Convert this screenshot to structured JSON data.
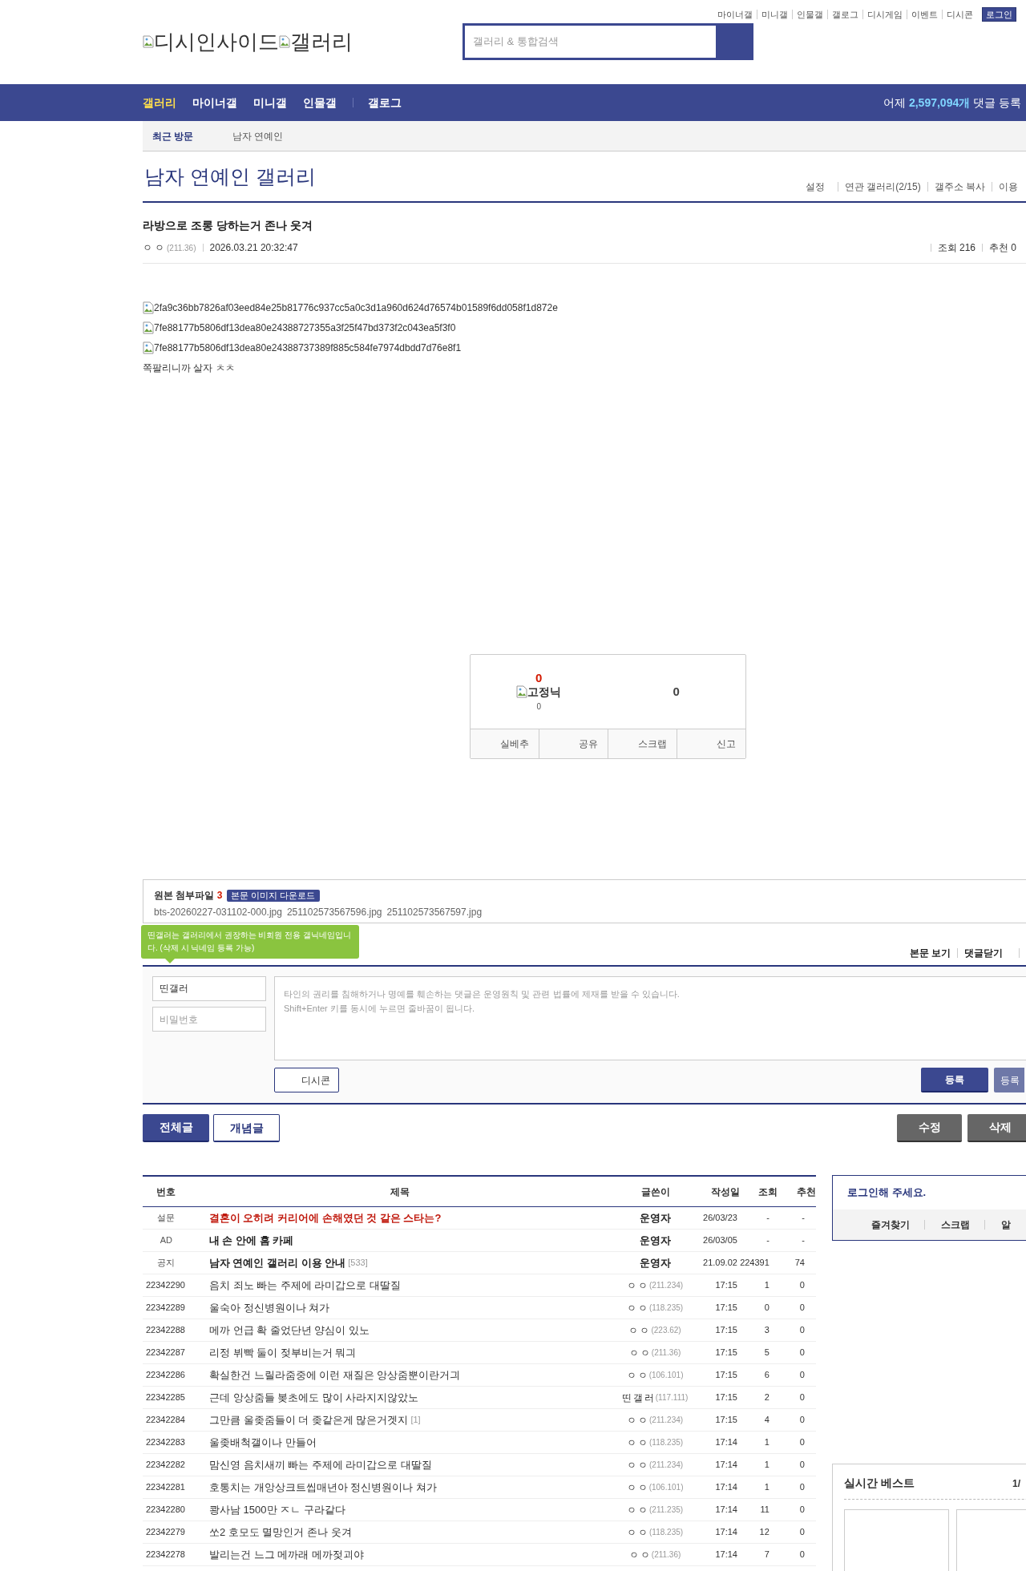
{
  "top_links": [
    "마이너갤",
    "미니갤",
    "인물갤",
    "갤로그",
    "디시게임",
    "이벤트",
    "디시콘"
  ],
  "login_button": "로그인",
  "logo": {
    "site": "디시인사이드",
    "gallery": "갤러리"
  },
  "search": {
    "placeholder": "갤러리 & 통합검색"
  },
  "nav": {
    "items": [
      {
        "label": "갤러리",
        "selected": true
      },
      {
        "label": "마이너갤",
        "selected": false
      },
      {
        "label": "미니갤",
        "selected": false
      },
      {
        "label": "인물갤",
        "selected": false
      },
      {
        "label": "갤로그",
        "selected": false
      }
    ],
    "stats": {
      "prefix": "어제",
      "count": "2,597,094개",
      "suffix": "댓글 등록"
    }
  },
  "recent": {
    "label": "최근 방문",
    "items": [
      "남자 연예인"
    ]
  },
  "gallery": {
    "title": "남자 연예인 갤러리",
    "links": [
      "설정",
      "연관 갤러리(2/15)",
      "갤주소 복사",
      "이용"
    ]
  },
  "post": {
    "title": "라방으로 조롱 당하는거 존나 웃겨",
    "author": "ㅇㅇ",
    "ip": "(211.36)",
    "date": "2026.03.21 20:32:47",
    "views": "조회 216",
    "recommends": "추천 0",
    "images": [
      "2fa9c36bb7826af03eed84e25b81776c937cc5a0c3d1a960d624d76574b01589f6dd058f1d872e",
      "7fe88177b5806df13dea80e24388727355a3f25f47bd373f2c043ea5f3f0",
      "7fe88177b5806df13dea80e24388737389f885c584fe7974dbdd7d76e8f1"
    ],
    "text": "쪽팔리니까 살자 ㅊㅊ"
  },
  "recommend": {
    "up_count": "0",
    "fixed_nick": "고정닉",
    "fixed_count": "0",
    "down_count": "0",
    "actions": [
      "실베추",
      "공유",
      "스크랩",
      "신고"
    ]
  },
  "attachments": {
    "label": "원본 첨부파일",
    "count": "3",
    "download": "본문 이미지 다운로드",
    "files": [
      "bts-20260227-031102-000.jpg",
      "251102573567596.jpg",
      "251102573567597.jpg"
    ]
  },
  "comments": {
    "links": [
      "본문 보기",
      "댓글닫기"
    ],
    "tooltip": "띤갤러는 갤러리에서 권장하는 비회원 전용 갤닉네임입니다. (삭제 시 닉네임 등록 가능)",
    "name_value": "띤갤러",
    "password_placeholder": "비밀번호",
    "textarea_placeholder": "타인의 권리를 침해하거나 명예를 훼손하는 댓글은 운영원칙 및 관련 법률에 제재를 받을 수 있습니다.\nShift+Enter 키를 동시에 누르면 줄바꿈이 됩니다.",
    "dccon": "디시콘",
    "submit": "등록",
    "submit_alt": "등록"
  },
  "list_buttons": {
    "left": [
      {
        "label": "전체글",
        "selected": true
      },
      {
        "label": "개념글",
        "selected": false
      }
    ],
    "right": [
      "수정",
      "삭제"
    ]
  },
  "table": {
    "columns": [
      "번호",
      "제목",
      "글쓴이",
      "작성일",
      "조회",
      "추천"
    ],
    "rows": [
      {
        "kind": "survey",
        "number": "설문",
        "title": "결혼이 오히려 커리어에 손해였던 것 같은 스타는?",
        "author": "운영자",
        "date": "26/03/23",
        "views": "-",
        "recommends": "-"
      },
      {
        "kind": "ad",
        "number": "AD",
        "title": "내 손 안에 홈 카페",
        "author": "운영자",
        "date": "26/03/05",
        "views": "-",
        "recommends": "-"
      },
      {
        "kind": "notice",
        "number": "공지",
        "title": "남자 연예인 갤러리 이용 안내",
        "comments": "[533]",
        "author": "운영자",
        "date": "21.09.02",
        "views": "224391",
        "recommends": "74"
      },
      {
        "kind": "post",
        "number": "22342290",
        "title": "음치 죄노 빠는 주제에 라미갑으로 대딸질",
        "author": "ㅇㅇ",
        "ip": "(211.234)",
        "date": "17:15",
        "views": "1",
        "recommends": "0"
      },
      {
        "kind": "post",
        "number": "22342289",
        "title": "울숙아 정신병원이나 쳐가",
        "author": "ㅇㅇ",
        "ip": "(118.235)",
        "date": "17:15",
        "views": "0",
        "recommends": "0"
      },
      {
        "kind": "post",
        "number": "22342288",
        "title": "메까 언급 확 줄었단년 양심이 있노",
        "author": "ㅇㅇ",
        "ip": "(223.62)",
        "date": "17:15",
        "views": "3",
        "recommends": "0"
      },
      {
        "kind": "post",
        "number": "22342287",
        "title": "리정 뷔빡 둘이 젖부비는거 뭐긔",
        "author": "ㅇㅇ",
        "ip": "(211.36)",
        "date": "17:15",
        "views": "5",
        "recommends": "0"
      },
      {
        "kind": "post",
        "number": "22342286",
        "title": "확실한건 느릴라줌중에 이런 재질은 앙상줌뿐이란거긔",
        "author": "ㅇㅇ",
        "ip": "(106.101)",
        "date": "17:15",
        "views": "6",
        "recommends": "0"
      },
      {
        "kind": "post",
        "number": "22342285",
        "title": "근데 앙상줌들 봊초에도 많이 사라지지않았노",
        "author": "띤갤러",
        "ip": "(117.111)",
        "date": "17:15",
        "views": "2",
        "recommends": "0"
      },
      {
        "kind": "post",
        "number": "22342284",
        "title": "그만큼 울좆줌들이 더 좆같은게 많은거겟지",
        "comments": "[1]",
        "author": "ㅇㅇ",
        "ip": "(211.234)",
        "date": "17:15",
        "views": "4",
        "recommends": "0"
      },
      {
        "kind": "post",
        "number": "22342283",
        "title": "울좆배척갤이나 만들어",
        "author": "ㅇㅇ",
        "ip": "(118.235)",
        "date": "17:14",
        "views": "1",
        "recommends": "0"
      },
      {
        "kind": "post",
        "number": "22342282",
        "title": "맘신영 음치새끼 빠는 주제에 라미갑으로 대딸질",
        "author": "ㅇㅇ",
        "ip": "(211.234)",
        "date": "17:14",
        "views": "1",
        "recommends": "0"
      },
      {
        "kind": "post",
        "number": "22342281",
        "title": "호통치는 개앙상크트씹매년아 정신병원이나 쳐가",
        "author": "ㅇㅇ",
        "ip": "(106.101)",
        "date": "17:14",
        "views": "1",
        "recommends": "0"
      },
      {
        "kind": "post",
        "number": "22342280",
        "title": "쾅사남 1500만 ㅈㄴ 구라같다",
        "author": "ㅇㅇ",
        "ip": "(211.235)",
        "date": "17:14",
        "views": "11",
        "recommends": "0"
      },
      {
        "kind": "post",
        "number": "22342279",
        "title": "쏘2 호모도 멸망인거 존나 웃겨",
        "author": "ㅇㅇ",
        "ip": "(118.235)",
        "date": "17:14",
        "views": "12",
        "recommends": "0"
      },
      {
        "kind": "post",
        "number": "22342278",
        "title": "발리는건 느그 메까래 메까젖괴야",
        "author": "ㅇㅇ",
        "ip": "(211.36)",
        "date": "17:14",
        "views": "7",
        "recommends": "0"
      }
    ]
  },
  "sidebar": {
    "login_prompt": "로그인해 주세요.",
    "links": [
      "즐겨찾기",
      "스크랩",
      "알"
    ],
    "best_title": "실시간 베스트",
    "best_page": "1/"
  }
}
